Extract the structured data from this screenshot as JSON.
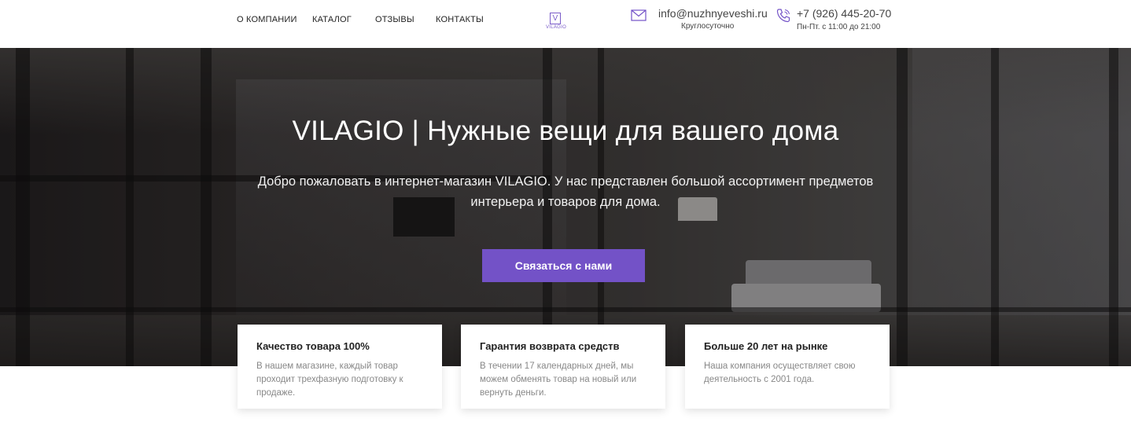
{
  "nav": {
    "items": [
      {
        "label": "О КОМПАНИИ"
      },
      {
        "label": "КАТАЛОГ"
      },
      {
        "label": "ОТЗЫВЫ"
      },
      {
        "label": "КОНТАКТЫ"
      }
    ]
  },
  "logo": {
    "mark": "V",
    "text": "VILAGIO"
  },
  "contacts": {
    "email": "info@nuzhnyeveshi.ru",
    "email_note": "Круглосуточно",
    "phone": "+7 (926) 445-20-70",
    "phone_note": "Пн-Пт. с 11:00 до 21:00"
  },
  "hero": {
    "title": "VILAGIO | Нужные вещи для вашего дома",
    "description": "Добро пожаловать в интернет-магазин VILAGIO. У нас представлен большой ассортимент предметов интерьера и товаров для дома.",
    "cta_label": "Связаться с нами"
  },
  "features": [
    {
      "title": "Качество товара 100%",
      "text": "В нашем магазине, каждый товар проходит трехфазную подготовку к продаже."
    },
    {
      "title": "Гарантия возврата средств",
      "text": "В течении 17 календарных дней, мы можем обменять товар на новый или вернуть деньги."
    },
    {
      "title": "Больше 20 лет на рынке",
      "text": "Наша компания осуществляет свою деятельность с 2001 года."
    }
  ],
  "colors": {
    "accent": "#7352c7",
    "logo": "#7a5cc9"
  },
  "icons": {
    "email": "envelope-icon",
    "phone": "phone-icon"
  }
}
